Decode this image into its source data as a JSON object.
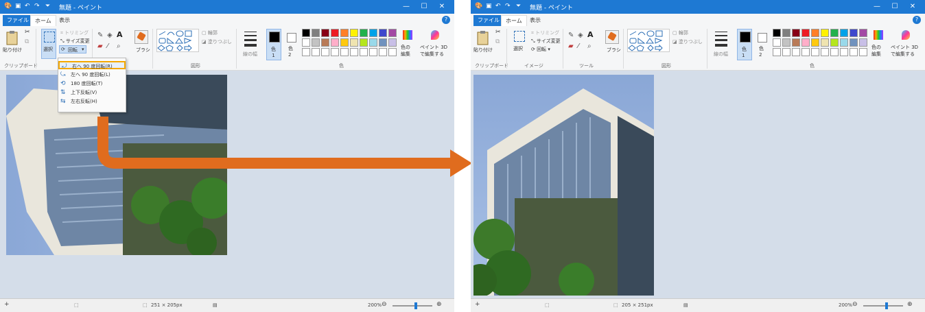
{
  "titlebar": {
    "title": "無題 - ペイント",
    "qa_icons": [
      "paint-app-icon",
      "save-icon",
      "undo-icon",
      "redo-icon"
    ],
    "minimize": "—",
    "maximize": "☐",
    "close": "✕"
  },
  "tabs": {
    "file": "ファイル",
    "home": "ホーム",
    "view": "表示"
  },
  "ribbon": {
    "paste": "貼り付け",
    "trim": "トリミング",
    "resize": "サイズ変更",
    "rotate": "回転",
    "select": "選択",
    "brush": "ブラシ",
    "outline": "輪郭",
    "fill": "塗りつぶし",
    "line_width": "線の幅",
    "color1": "色\n1",
    "color2": "色\n2",
    "edit_colors": "色の\n編集",
    "paint3d": "ペイント 3D\nで編集する",
    "groups_left": {
      "clipboard": "クリップボード",
      "shapes": "図形",
      "colors": "色"
    },
    "groups_right": {
      "clipboard": "クリップボード",
      "image": "イメージ",
      "tools": "ツール",
      "shapes": "図形",
      "colors": "色"
    }
  },
  "rotate_menu": {
    "items": [
      "右へ 90 度回転(R)",
      "左へ 90 度回転(L)",
      "180 度回転(T)",
      "上下反転(V)",
      "左右反転(H)"
    ],
    "highlighted": 0
  },
  "palette": {
    "row1": [
      "#000000",
      "#7f7f7f",
      "#880015",
      "#ed1c24",
      "#ff7f27",
      "#fff200",
      "#22b14c",
      "#00a2e8",
      "#3f48cc",
      "#a349a4"
    ],
    "row2": [
      "#ffffff",
      "#c3c3c3",
      "#b97a57",
      "#ffaec9",
      "#ffc90e",
      "#efe4b0",
      "#b5e61d",
      "#99d9ea",
      "#7092be",
      "#c8bfe7"
    ]
  },
  "status_left": {
    "size": "251 × 205px",
    "zoom": "200%"
  },
  "status_right": {
    "size": "205 × 251px",
    "zoom": "200%"
  },
  "colors": {
    "accent": "#1e79d3",
    "canvas_bg": "#d4dde9",
    "arrow": "#e06c1e",
    "highlight": "#f5a800"
  }
}
